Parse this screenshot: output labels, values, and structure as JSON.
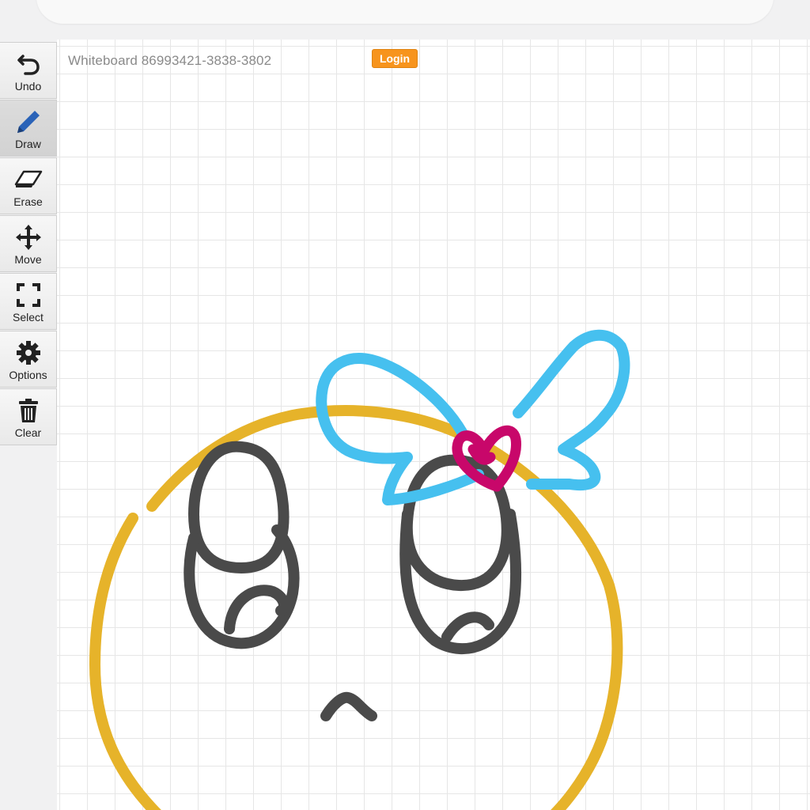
{
  "board": {
    "title": "Whiteboard 86993421-3838-3802",
    "login_label": "Login"
  },
  "toolbar": {
    "tools": [
      {
        "label": "Undo",
        "icon": "undo-icon",
        "active": false
      },
      {
        "label": "Draw",
        "icon": "pencil-icon",
        "active": true
      },
      {
        "label": "Erase",
        "icon": "eraser-icon",
        "active": false
      },
      {
        "label": "Move",
        "icon": "move-icon",
        "active": false
      },
      {
        "label": "Select",
        "icon": "select-icon",
        "active": false
      },
      {
        "label": "Options",
        "icon": "gear-icon",
        "active": false
      },
      {
        "label": "Clear",
        "icon": "trash-icon",
        "active": false
      }
    ]
  },
  "colors": {
    "face": "#e6b32a",
    "eyes": "#4a4a4a",
    "bow": "#46c0ef",
    "heart": "#c8076a",
    "login": "#f7941d",
    "draw_icon": "#2a63b8"
  }
}
